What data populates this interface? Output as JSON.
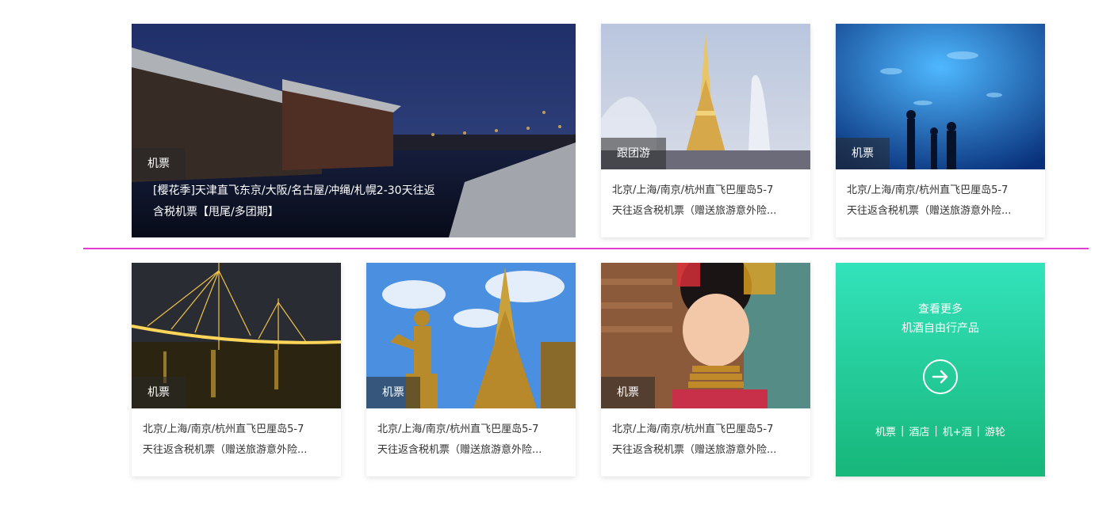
{
  "feature": {
    "tag": "机票",
    "title_line1": "[樱花季]天津直飞东京/大阪/名古屋/冲绳/札幌2-30天往返",
    "title_line2": "含税机票【甩尾/多团期】"
  },
  "cards": [
    {
      "tag": "跟团游",
      "line1": "北京/上海/南京/杭州直飞巴厘岛5-7",
      "line2": "天往返含税机票（赠送旅游意外险..."
    },
    {
      "tag": "机票",
      "line1": "北京/上海/南京/杭州直飞巴厘岛5-7",
      "line2": "天往返含税机票（赠送旅游意外险..."
    },
    {
      "tag": "机票",
      "line1": "北京/上海/南京/杭州直飞巴厘岛5-7",
      "line2": "天往返含税机票（赠送旅游意外险..."
    },
    {
      "tag": "机票",
      "line1": "北京/上海/南京/杭州直飞巴厘岛5-7",
      "line2": "天往返含税机票（赠送旅游意外险..."
    },
    {
      "tag": "机票",
      "line1": "北京/上海/南京/杭州直飞巴厘岛5-7",
      "line2": "天往返含税机票（赠送旅游意外险..."
    }
  ],
  "more": {
    "line1": "查看更多",
    "line2": "机酒自由行产品",
    "links": [
      "机票",
      "酒店",
      "机+酒",
      "游轮"
    ],
    "separator": "|",
    "arrow_icon": "arrow-right-circle-icon"
  },
  "colors": {
    "divider": "#e33ad1",
    "more_gradient_top": "#33e3bb",
    "more_gradient_bottom": "#17b67a"
  }
}
